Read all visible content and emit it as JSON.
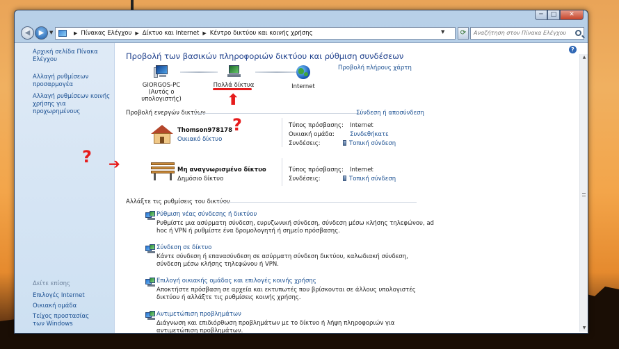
{
  "window": {
    "caption_min": "─",
    "caption_max": "□",
    "caption_close": "✕"
  },
  "nav": {
    "back": "◀",
    "forward": "▶",
    "dropdown": "▼",
    "refresh": "⟳",
    "breadcrumbs": [
      "Πίνακας Ελέγχου",
      "Δίκτυο και Internet",
      "Κέντρο δικτύου και κοινής χρήσης"
    ],
    "crumb_sep": "▶",
    "search_placeholder": "Αναζήτηση στον Πίνακα Ελέγχου"
  },
  "sidebar": {
    "links": [
      "Αρχική σελίδα Πίνακα Ελέγχου",
      "Αλλαγή ρυθμίσεων προσαρμογέα",
      "Αλλαγή ρυθμίσεων κοινής χρήσης για προχωρημένους"
    ],
    "see_also_title": "Δείτε επίσης",
    "see_also": [
      "Επιλογές Internet",
      "Οικιακή ομάδα",
      "Τείχος προστασίας των Windows"
    ]
  },
  "main": {
    "help": "?",
    "title": "Προβολή των βασικών πληροφοριών δικτύου και ρύθμιση συνδέσεων",
    "full_map_link": "Προβολή πλήρους χάρτη",
    "map": {
      "pc_name": "GIORGOS-PC",
      "pc_sub": "(Αυτός ο υπολογιστής)",
      "network": "Πολλά δίκτυα",
      "internet": "Internet"
    },
    "active_title": "Προβολή ενεργών δικτύων",
    "connect_link": "Σύνδεση ή αποσύνδεση",
    "networks": [
      {
        "name": "Thomson978178",
        "type": "Οικιακό δίκτυο",
        "access_label": "Τύπος πρόσβασης:",
        "access_value": "Internet",
        "homegroup_label": "Οικιακή ομάδα:",
        "homegroup_value": "Συνδεθήκατε",
        "conn_label": "Συνδέσεις:",
        "conn_value": "Τοπική σύνδεση"
      },
      {
        "name": "Μη αναγνωρισμένο δίκτυο",
        "type": "Δημόσιο δίκτυο",
        "access_label": "Τύπος πρόσβασης:",
        "access_value": "Internet",
        "conn_label": "Συνδέσεις:",
        "conn_value": "Τοπική σύνδεση"
      }
    ],
    "settings_title": "Αλλάξτε τις ρυθμίσεις του δικτύου",
    "tasks": [
      {
        "title": "Ρύθμιση νέας σύνδεσης ή δικτύου",
        "desc": "Ρυθμίστε μια ασύρματη σύνδεση, ευρυζωνική σύνδεση, σύνδεση μέσω κλήσης τηλεφώνου, ad hoc ή VPN ή ρυθμίστε ένα δρομολογητή ή σημείο πρόσβασης."
      },
      {
        "title": "Σύνδεση σε δίκτυο",
        "desc": "Κάντε σύνδεση ή επανασύνδεση σε ασύρματη σύνδεση δικτύου, καλωδιακή σύνδεση, σύνδεση μέσω κλήσης τηλεφώνου ή VPN."
      },
      {
        "title": "Επιλογή οικιακής ομάδας και επιλογές κοινής χρήσης",
        "desc": "Αποκτήστε πρόσβαση σε αρχεία και εκτυπωτές που βρίσκονται σε άλλους υπολογιστές δικτύου ή αλλάξτε τις ρυθμίσεις κοινής χρήσης."
      },
      {
        "title": "Αντιμετώπιση προβλημάτων",
        "desc": "Διάγνωση και επιδιόρθωση προβλημάτων με το δίκτυο ή λήψη πληροφοριών για αντιμετώπιση προβλημάτων."
      }
    ]
  },
  "annotations": {
    "question": "?",
    "arrow_right": "➔",
    "arrow_up": "⬆",
    "color": "#e61c1c"
  },
  "colors": {
    "link": "#1a4f91",
    "title": "#1a3c8a",
    "sidebar_bg": "#dfeaf6"
  },
  "icons": {
    "pc": "computer-icon",
    "network": "network-icon",
    "internet": "globe-icon",
    "home_network": "house-icon",
    "public_network": "bench-icon",
    "connection": "ethernet-connection-icon",
    "task": "network-task-icon",
    "help": "help-icon",
    "search": "search-icon"
  }
}
